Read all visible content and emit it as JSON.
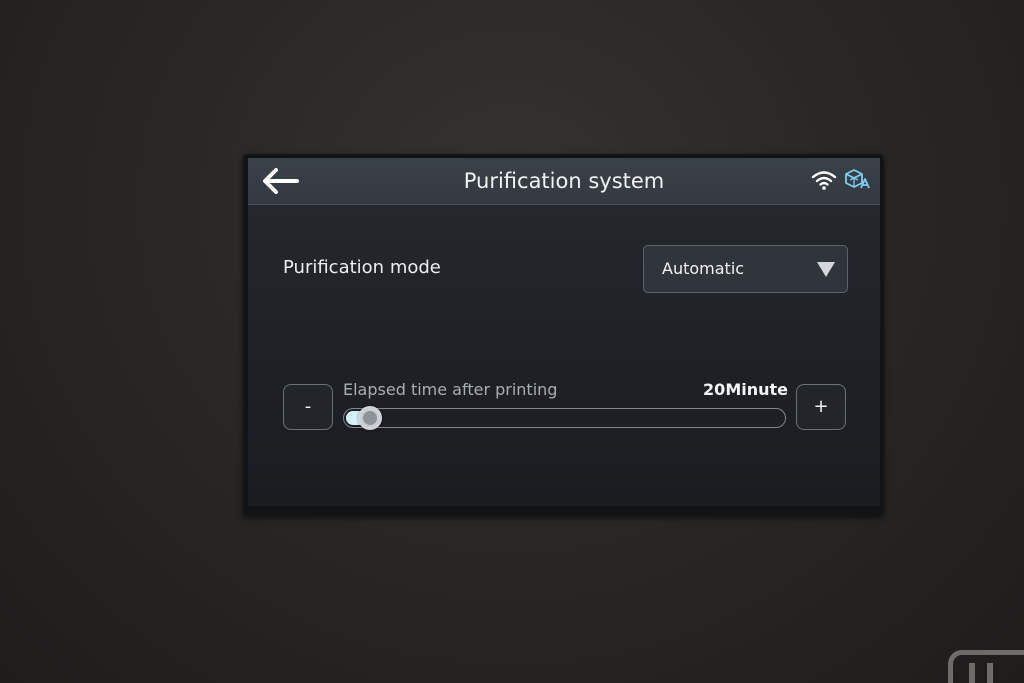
{
  "header": {
    "title": "Purification system"
  },
  "purification_mode": {
    "label": "Purification mode",
    "selected": "Automatic"
  },
  "elapsed_time": {
    "label": "Elapsed time after printing",
    "value_text": "20Minute",
    "slider_fraction": 0.06,
    "decrement_label": "-",
    "increment_label": "+"
  },
  "icons": {
    "back": "arrow-left-icon",
    "wifi": "wifi-icon",
    "printer": "printer-status-icon",
    "dropdown": "chevron-down-icon"
  },
  "colors": {
    "accent": "#7ecdf0",
    "slider_fill": "#d6f0fb",
    "header_bg": "#3b4149",
    "screen_bg": "#1e2126"
  }
}
